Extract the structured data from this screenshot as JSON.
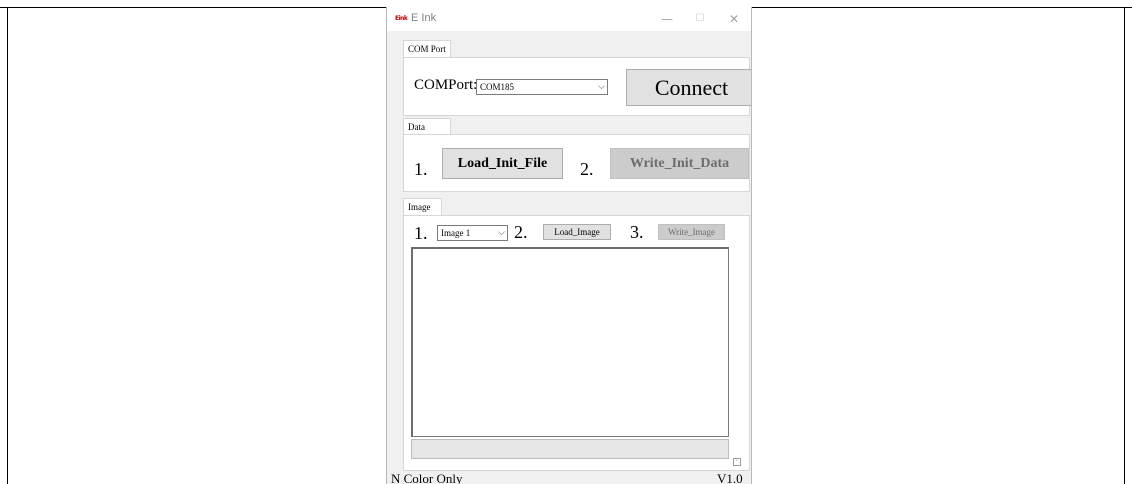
{
  "window": {
    "title": "E Ink",
    "app_icon_text": "Eink",
    "controls": {
      "minimize": "—",
      "maximize": "☐",
      "close": "✕"
    }
  },
  "com_port": {
    "tab_label": "COM Port",
    "label": "COMPort:",
    "selected": "COM185",
    "connect_label": "Connect"
  },
  "data_section": {
    "tab_label": "Data",
    "step1": "1.",
    "load_label": "Load_Init_File",
    "step2": "2.",
    "write_label": "Write_Init_Data"
  },
  "image_section": {
    "tab_label": "Image",
    "step1": "1.",
    "selected_image": "Image 1",
    "step2": "2.",
    "load_label": "Load_Image",
    "step3": "3.",
    "write_label": "Write_Image",
    "progress": 0
  },
  "status_bar": {
    "left_text": "N Color Only",
    "version": "V1.0"
  },
  "colors": {
    "window_bg": "#f0f0f0",
    "panel_bg": "#ffffff",
    "button_bg": "#e1e1e1",
    "disabled_bg": "#cccccc",
    "brand_red": "#c00000"
  }
}
